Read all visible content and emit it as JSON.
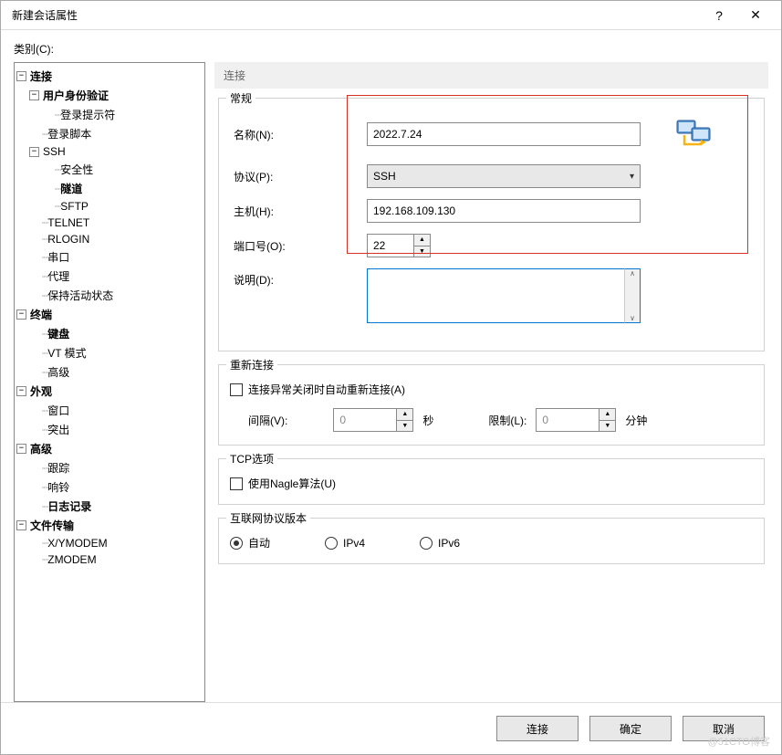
{
  "titlebar": {
    "title": "新建会话属性",
    "help": "?",
    "close": "✕"
  },
  "category_label": "类别(C):",
  "tree": {
    "connection": "连接",
    "user_auth": "用户身份验证",
    "login_prompt": "登录提示符",
    "login_script": "登录脚本",
    "ssh": "SSH",
    "security": "安全性",
    "tunnel": "隧道",
    "sftp": "SFTP",
    "telnet": "TELNET",
    "rlogin": "RLOGIN",
    "serial": "串口",
    "proxy": "代理",
    "keepalive": "保持活动状态",
    "terminal": "终端",
    "keyboard": "键盘",
    "vtmode": "VT 模式",
    "advanced_term": "高级",
    "appearance": "外观",
    "window": "窗口",
    "popup": "突出",
    "advanced": "高级",
    "trace": "跟踪",
    "bell": "响铃",
    "logging": "日志记录",
    "filetransfer": "文件传输",
    "xymodem": "X/YMODEM",
    "zmodem": "ZMODEM"
  },
  "content": {
    "header": "连接",
    "general": {
      "legend": "常规",
      "name_label": "名称(N):",
      "name_value": "2022.7.24",
      "protocol_label": "协议(P):",
      "protocol_value": "SSH",
      "host_label": "主机(H):",
      "host_value": "192.168.109.130",
      "port_label": "端口号(O):",
      "port_value": "22",
      "desc_label": "说明(D):",
      "desc_value": ""
    },
    "reconnect": {
      "legend": "重新连接",
      "checkbox_label": "连接异常关闭时自动重新连接(A)",
      "interval_label": "间隔(V):",
      "interval_value": "0",
      "interval_unit": "秒",
      "limit_label": "限制(L):",
      "limit_value": "0",
      "limit_unit": "分钟"
    },
    "tcp": {
      "legend": "TCP选项",
      "nagle_label": "使用Nagle算法(U)"
    },
    "ipver": {
      "legend": "互联网协议版本",
      "auto": "自动",
      "ipv4": "IPv4",
      "ipv6": "IPv6"
    }
  },
  "buttons": {
    "connect": "连接",
    "ok": "确定",
    "cancel": "取消"
  },
  "watermark": "@51CTO博客"
}
